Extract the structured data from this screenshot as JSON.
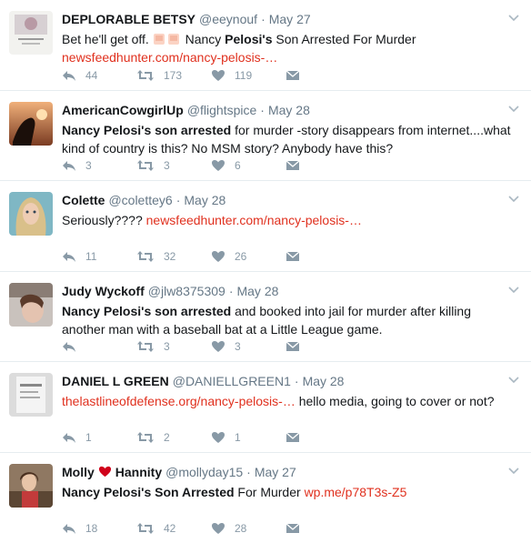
{
  "colors": {
    "link": "#e0301e",
    "action": "#8899a6",
    "heart": "#e0245e"
  },
  "tweets": [
    {
      "name": "DEPLORABLE BETSY",
      "handle": "@eeynouf",
      "time": "May 27",
      "text_before": "Bet he'll get off.",
      "text_bold": "",
      "text_mid": " Nancy ",
      "text_bold2": "Pelosi's",
      "text_after": " Son Arrested For Murder",
      "link": "newsfeedhunter.com/nancy-pelosis-…",
      "replies": "44",
      "retweets": "173",
      "likes": "119"
    },
    {
      "name": "AmericanCowgirlUp",
      "handle": "@flightspice",
      "time": "May 28",
      "text_bold": "Nancy Pelosi's son arrested",
      "text_after": " for murder -story disappears from internet....what kind of country is this? No MSM story? Anybody have this?",
      "replies": "3",
      "retweets": "3",
      "likes": "6"
    },
    {
      "name": "Colette",
      "handle": "@colettey6",
      "time": "May 28",
      "text_before": "Seriously???? ",
      "link": "newsfeedhunter.com/nancy-pelosis-…",
      "replies": "11",
      "retweets": "32",
      "likes": "26"
    },
    {
      "name": "Judy Wyckoff",
      "handle": "@jlw8375309",
      "time": "May 28",
      "text_bold": "Nancy Pelosi's son arrested",
      "text_after": " and booked into jail for murder after killing another man with a baseball bat at a Little League game.",
      "replies": "",
      "retweets": "3",
      "likes": "3"
    },
    {
      "name": "DANIEL L GREEN",
      "handle": "@DANIELLGREEN1",
      "time": "May 28",
      "link": "thelastlineofdefense.org/nancy-pelosis-…",
      "text_after": " hello media, going to cover or not?",
      "replies": "1",
      "retweets": "2",
      "likes": "1"
    },
    {
      "name_first": "Molly",
      "name_last": "Hannity",
      "handle": "@mollyday15",
      "time": "May 27",
      "text_bold": "Nancy Pelosi's Son Arrested",
      "text_after": " For Murder ",
      "link": "wp.me/p78T3s-Z5",
      "replies": "18",
      "retweets": "42",
      "likes": "28"
    }
  ]
}
